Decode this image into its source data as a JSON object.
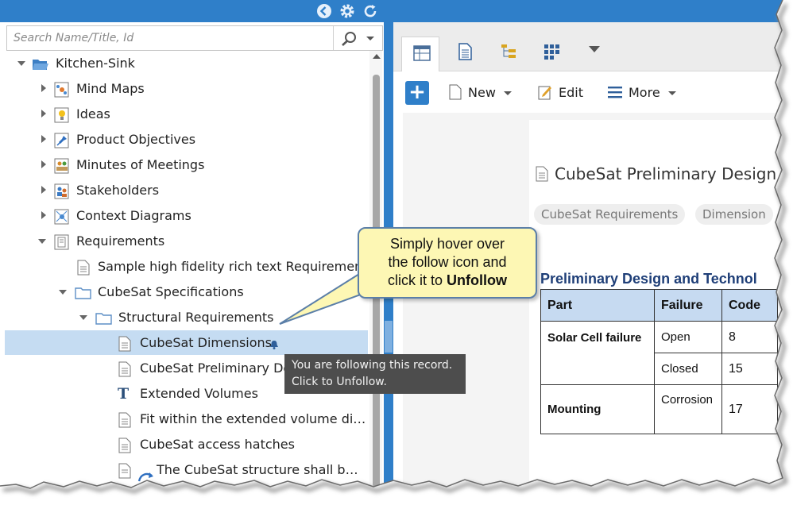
{
  "search": {
    "placeholder": "Search Name/Title, Id"
  },
  "tree": {
    "items": [
      {
        "label": "Kitchen-Sink"
      },
      {
        "label": "Mind Maps"
      },
      {
        "label": "Ideas"
      },
      {
        "label": "Product Objectives"
      },
      {
        "label": "Minutes of Meetings"
      },
      {
        "label": "Stakeholders"
      },
      {
        "label": "Context Diagrams"
      },
      {
        "label": "Requirements"
      },
      {
        "label": "Sample high fidelity rich text Requirement"
      },
      {
        "label": "CubeSat Specifications"
      },
      {
        "label": "Structural Requirements"
      },
      {
        "label": "CubeSat Dimensions"
      },
      {
        "label": "CubeSat Preliminary Design"
      },
      {
        "label": "Extended Volumes"
      },
      {
        "label": "Fit within the extended volume di…"
      },
      {
        "label": "CubeSat access hatches"
      },
      {
        "label": "The CubeSat structure shall b…"
      }
    ]
  },
  "toolbar": {
    "new_label": "New",
    "edit_label": "Edit",
    "more_label": "More"
  },
  "doc": {
    "title": "CubeSat Preliminary Design",
    "chips": [
      "CubeSat Requirements",
      "Dimension"
    ],
    "section_heading": "Preliminary Design and Technol",
    "table": {
      "headers": [
        "Part",
        "Failure",
        "Code"
      ],
      "rows": [
        {
          "part": "Solar Cell failure",
          "failure": "Open",
          "code": "8"
        },
        {
          "part": "",
          "failure": "Closed",
          "code": "15"
        },
        {
          "part": "Mounting",
          "failure": "Corrosion",
          "code": "17"
        }
      ]
    }
  },
  "callout": {
    "line1": "Simply hover over",
    "line2": "the follow icon and",
    "line3_prefix": "click it to ",
    "line3_bold": "Unfollow"
  },
  "tooltip": {
    "line1": "You are following this record.",
    "line2": "Click to Unfollow."
  },
  "colors": {
    "accent": "#2f7fc9",
    "selected_row": "#c5dcf2",
    "callout_bg": "#fdf7b4",
    "table_header": "#c6daf1",
    "heading": "#1f3f78"
  },
  "icons": {
    "topbar": [
      "back-arrow-icon",
      "gear-icon",
      "refresh-icon"
    ],
    "tabs": [
      "grid-view-icon",
      "document-icon",
      "tree-view-icon",
      "matrix-icon",
      "more-tabs-icon"
    ]
  }
}
